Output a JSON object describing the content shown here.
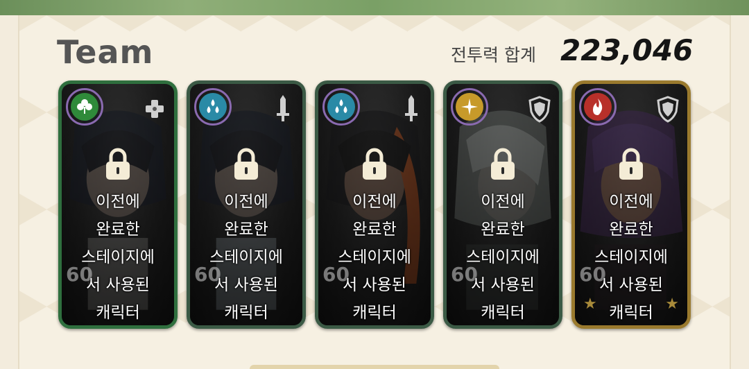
{
  "header": {
    "title": "Team",
    "power_label": "전투력 합계",
    "power_value": "223,046"
  },
  "cards": [
    {
      "element": "clover-icon",
      "element_color": "#2f8a3a",
      "role": "plus-cross-icon",
      "level": "60",
      "locked": true,
      "message_lines": [
        "이전에",
        "완료한",
        "스테이지에",
        "서 사용된",
        "캐릭터"
      ]
    },
    {
      "element": "water-drops-icon",
      "element_color": "#2a8aa6",
      "role": "sword-icon",
      "level": "60",
      "locked": true,
      "message_lines": [
        "이전에",
        "완료한",
        "스테이지에",
        "서 사용된",
        "캐릭터"
      ]
    },
    {
      "element": "water-drops-icon",
      "element_color": "#2a8aa6",
      "role": "sword-icon",
      "level": "60",
      "locked": true,
      "message_lines": [
        "이전에",
        "완료한",
        "스테이지에",
        "서 사용된",
        "캐릭터"
      ]
    },
    {
      "element": "compass-star-icon",
      "element_color": "#c79a2a",
      "role": "shield-icon",
      "level": "60",
      "locked": true,
      "message_lines": [
        "이전에",
        "완료한",
        "스테이지에",
        "서 사용된",
        "캐릭터"
      ]
    },
    {
      "element": "flame-icon",
      "element_color": "#b8302a",
      "role": "shield-icon",
      "level": "60",
      "locked": true,
      "message_lines": [
        "이전에",
        "완료한",
        "스테이지에",
        "서 사용된",
        "캐릭터"
      ]
    }
  ],
  "colors": {
    "panel_bg": "#f6f0e2",
    "title": "#555555",
    "power_value": "#151515"
  }
}
